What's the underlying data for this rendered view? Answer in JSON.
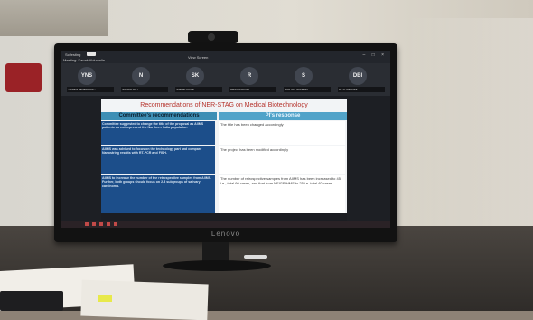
{
  "app": {
    "name": "Scifesting",
    "meeting_label": "Meeting: Kanak Ahluwalia",
    "sharing_label": "View Screen"
  },
  "participants": [
    {
      "initials": "YNS",
      "name": "Yerlatha NESEDHAM..."
    },
    {
      "initials": "N",
      "name": "NIRMAL DBT"
    },
    {
      "initials": "SK",
      "name": "Shahab Kumar"
    },
    {
      "initials": "R",
      "name": "RENGANAYAKI"
    },
    {
      "initials": "S",
      "name": "SURYAN GANESH"
    },
    {
      "initials": "DBI",
      "name": "Dr. B. Ravindra"
    }
  ],
  "slide": {
    "title": "Recommendations of NER-STAG on Medical Biotechnology",
    "col_left": "Committee's recommendations",
    "col_right": "PI's response",
    "rows": [
      {
        "rec": "Committee suggested to change the title of the proposal as AIIMS patients do not represent the Northern India population",
        "resp": "The title has been changed accordingly"
      },
      {
        "rec": "AIIMS was advised to focus on the technology part and compare Nanostring results with RT-PCR and FISH.",
        "resp": "The project has been modified accordingly"
      },
      {
        "rec": "AIIMS to increase the number of the retrospective samples from AIIMS. Further, both groups should focus on 2-3 subgroups of salivary carcinoma.",
        "resp": "The number of retrospective samples from AIIMS has been increased to 45 i.e., total 60 cases, and that from NEIGRIHMS to 25 i.e. total 40 cases."
      }
    ]
  },
  "monitor": {
    "brand": "Lenovo"
  }
}
